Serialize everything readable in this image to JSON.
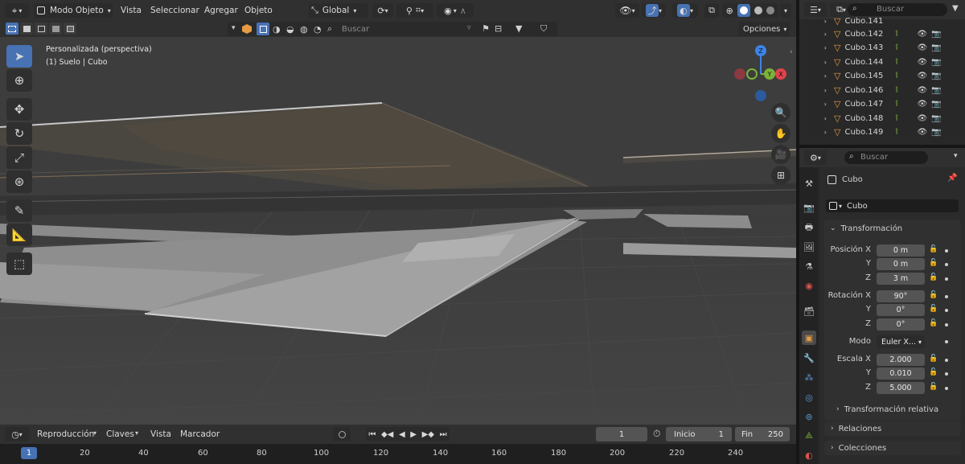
{
  "view_header": {
    "mode": "Modo Objeto",
    "menu": [
      "Vista",
      "Seleccionar",
      "Agregar",
      "Objeto"
    ],
    "transform_orientation": "Global"
  },
  "view_sub": {
    "search_placeholder": "Buscar",
    "options": "Opciones"
  },
  "overlay": {
    "view_name": "Personalizada (perspectiva)",
    "collection": "(1) Suelo | Cubo"
  },
  "gizmo": {
    "z": "Z",
    "y": "Y",
    "x": "X"
  },
  "timeline": {
    "menu": [
      "Reproducción",
      "Claves",
      "Vista",
      "Marcador"
    ],
    "current_frame": "1",
    "start_label": "Inicio",
    "start": "1",
    "end_label": "Fin",
    "end": "250",
    "ruler": [
      "1",
      "20",
      "40",
      "60",
      "80",
      "100",
      "120",
      "140",
      "160",
      "180",
      "200",
      "220",
      "240"
    ]
  },
  "outliner": {
    "search_placeholder": "Buscar",
    "items": [
      "Cubo.141",
      "Cubo.142",
      "Cubo.143",
      "Cubo.144",
      "Cubo.145",
      "Cubo.146",
      "Cubo.147",
      "Cubo.148",
      "Cubo.149"
    ]
  },
  "properties": {
    "search_placeholder": "Buscar",
    "object_name": "Cubo",
    "object_field": "Cubo",
    "transform_title": "Transformación",
    "location_label": "Posición X",
    "y_label": "Y",
    "z_label": "Z",
    "location": [
      "0 m",
      "0 m",
      "3 m"
    ],
    "rotation_label": "Rotación X",
    "rotation": [
      "90°",
      "0°",
      "0°"
    ],
    "mode_label": "Modo",
    "mode_value": "Euler X...",
    "scale_label": "Escala X",
    "scale": [
      "2.000",
      "0.010",
      "5.000"
    ],
    "delta_title": "Transformación relativa",
    "relations_title": "Relaciones",
    "collections_title": "Colecciones"
  },
  "colors": {
    "accent": "#4772b3",
    "object_orange": "#e59b45",
    "axis_x": "#e2424c",
    "axis_y": "#7bb238",
    "axis_z": "#3d83e8"
  }
}
